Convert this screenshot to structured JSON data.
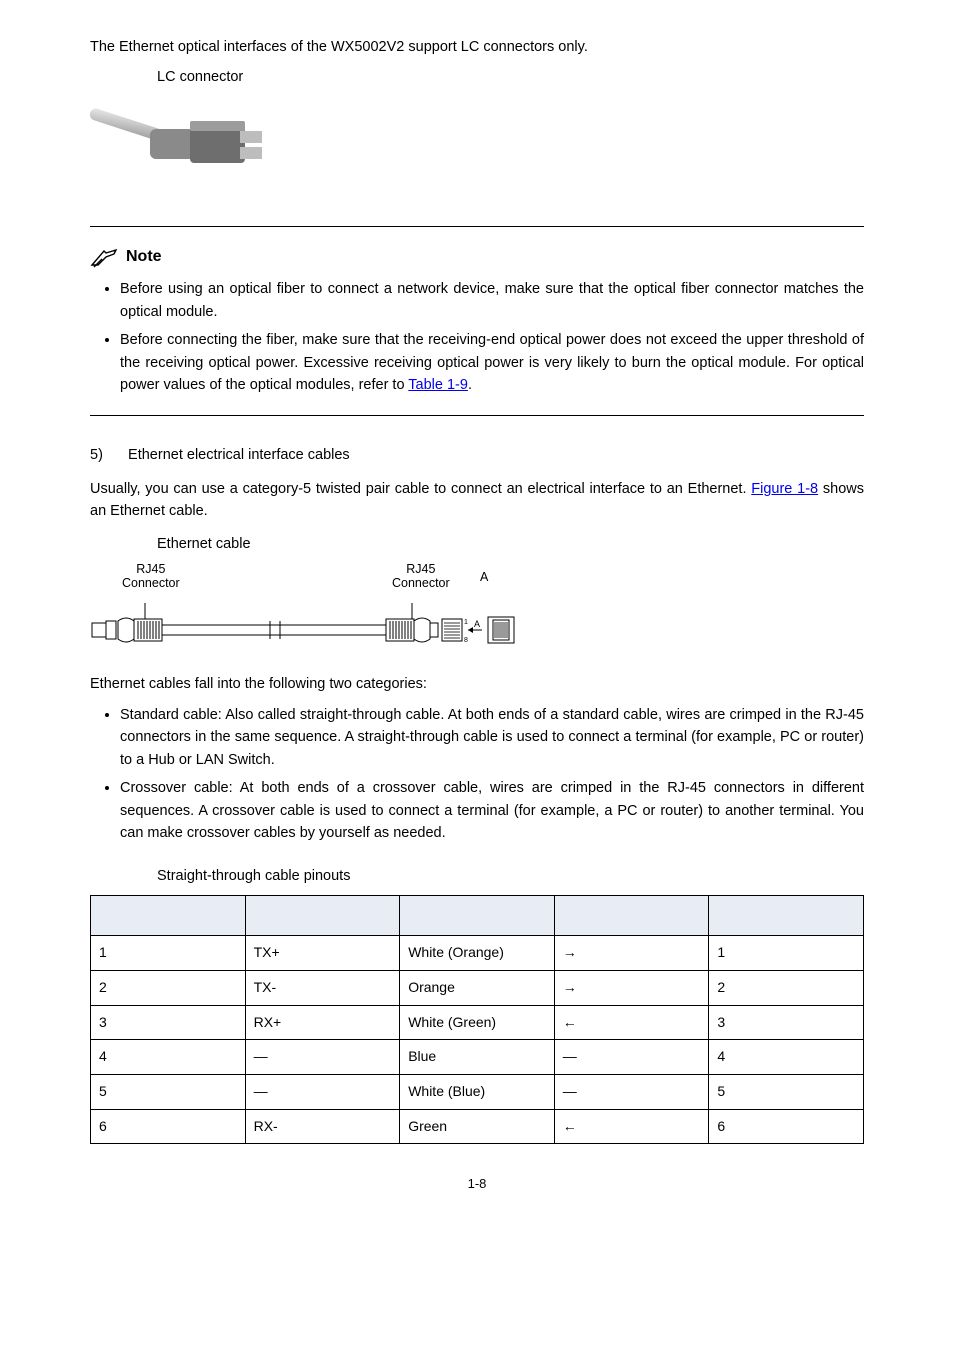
{
  "intro_line": "The Ethernet optical interfaces of the WX5002V2 support LC connectors only.",
  "fig7_caption": "LC connector",
  "note_label": "Note",
  "notes": [
    {
      "text_before_link": "Before using an optical fiber to connect a network device, make sure that the optical fiber connector matches the optical module.",
      "link_text": "",
      "text_after_link": ""
    },
    {
      "text_before_link": "Before connecting the fiber, make sure that the receiving-end optical power does not exceed the upper threshold of the receiving optical power. Excessive receiving optical power is very likely to burn the optical module. For optical power values of the optical modules, refer to ",
      "link_text": "Table 1-9",
      "text_after_link": "."
    }
  ],
  "step5_num": "5)",
  "step5_title": "Ethernet electrical interface cables",
  "p_usually_before": "Usually, you can use a category-5 twisted pair cable to connect an electrical interface to an Ethernet. ",
  "p_usually_link": "Figure 1-8",
  "p_usually_after": " shows an Ethernet cable.",
  "fig8_caption": "Ethernet cable",
  "rj45_label": "RJ45\nConnector",
  "sideA_label": "A",
  "categories_intro": "Ethernet cables fall into the following two categories:",
  "cable_types": [
    "Standard cable: Also called straight-through cable. At both ends of a standard cable, wires are crimped in the RJ-45 connectors in the same sequence. A straight-through cable is used to connect a terminal (for example, PC or router) to a Hub or LAN Switch.",
    "Crossover cable: At both ends of a crossover cable, wires are crimped in the RJ-45 connectors in different sequences. A crossover cable is used to connect a terminal (for example, a PC or router) to another terminal. You can make crossover cables by yourself as needed."
  ],
  "table_title": "Straight-through cable pinouts",
  "table_rows": [
    {
      "c0": "1",
      "c1": "TX+",
      "c2": "White (Orange)",
      "c3": "→",
      "c4": "1"
    },
    {
      "c0": "2",
      "c1": "TX-",
      "c2": "Orange",
      "c3": "→",
      "c4": "2"
    },
    {
      "c0": "3",
      "c1": "RX+",
      "c2": "White (Green)",
      "c3": "←",
      "c4": "3"
    },
    {
      "c0": "4",
      "c1": "—",
      "c2": "Blue",
      "c3": "—",
      "c4": "4"
    },
    {
      "c0": "5",
      "c1": "—",
      "c2": "White (Blue)",
      "c3": "—",
      "c4": "5"
    },
    {
      "c0": "6",
      "c1": "RX-",
      "c2": "Green",
      "c3": "←",
      "c4": "6"
    }
  ],
  "page_number": "1-8"
}
